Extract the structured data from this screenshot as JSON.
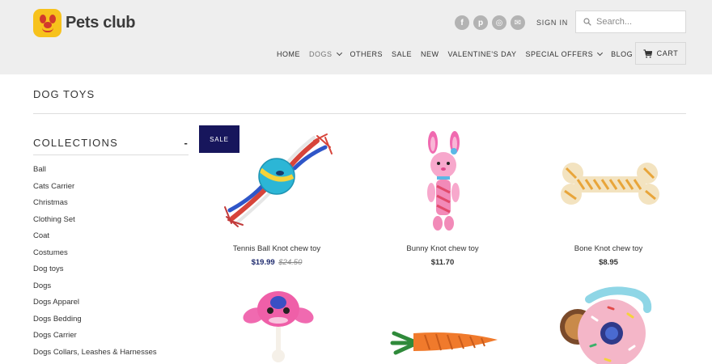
{
  "brand": {
    "name": "Pets club"
  },
  "header": {
    "socials": [
      {
        "icon": "facebook-icon",
        "glyph": "f"
      },
      {
        "icon": "pinterest-icon",
        "glyph": "p"
      },
      {
        "icon": "instagram-icon",
        "glyph": "◎"
      },
      {
        "icon": "email-icon",
        "glyph": "✉"
      }
    ],
    "signin_label": "SIGN IN",
    "search_placeholder": "Search...",
    "cart_label": "CART"
  },
  "nav": {
    "items": [
      "HOME",
      "DOGS",
      "OTHERS",
      "SALE",
      "NEW",
      "VALENTINE'S DAY",
      "SPECIAL OFFERS",
      "BLOG"
    ]
  },
  "page": {
    "title": "DOG TOYS"
  },
  "collections": {
    "heading": "COLLECTIONS",
    "toggle": "-",
    "items": [
      "Ball",
      "Cats Carrier",
      "Christmas",
      "Clothing Set",
      "Coat",
      "Costumes",
      "Dog toys",
      "Dogs",
      "Dogs Apparel",
      "Dogs Bedding",
      "Dogs Carrier",
      "Dogs Collars, Leashes & Harnesses"
    ]
  },
  "products": [
    {
      "name": "Tennis Ball Knot chew toy",
      "price": "$19.99",
      "compare_price": "$24.50",
      "badge": "SALE"
    },
    {
      "name": "Bunny Knot chew toy",
      "price": "$11.70"
    },
    {
      "name": "Bone Knot chew toy",
      "price": "$8.95"
    },
    {
      "name": ""
    },
    {
      "name": ""
    },
    {
      "name": ""
    }
  ],
  "colors": {
    "header_bg": "#eeeeee",
    "sale_badge": "#17165c",
    "sale_price": "#1e2a6e",
    "logo": "#f7c21c"
  }
}
